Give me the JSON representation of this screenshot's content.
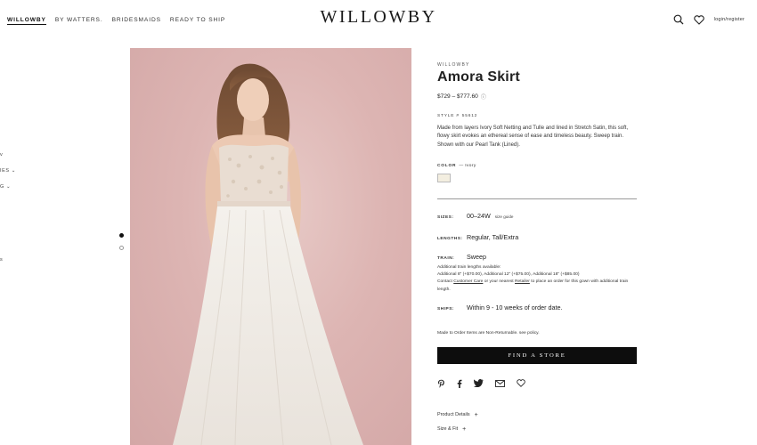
{
  "nav": {
    "links": [
      {
        "label": "WILLOWBY"
      },
      {
        "label": "BY WATTERS."
      },
      {
        "label": "BRIDESMAIDS"
      },
      {
        "label": "READY TO SHIP"
      }
    ],
    "logo": "WILLOWBY",
    "login": "login/register",
    "icons": [
      "search-icon",
      "heart-icon"
    ]
  },
  "side_fragments": [
    "v",
    "IES ⌄",
    "G ⌄",
    "s"
  ],
  "product": {
    "brand": "WILLOWBY",
    "title": "Amora Skirt",
    "price": "$729 – $777.60",
    "info_icon": "ⓘ",
    "style_label": "STYLE #",
    "style_number": "55612",
    "description": "Made from layers Ivory Soft Netting and Tulle and lined in Stretch Satin, this soft, flowy skirt evokes an ethereal sense of ease and timeless beauty. Sweep train. Shown with our Pearl Tank (Lined).",
    "color_label": "COLOR",
    "color_value": "— Ivory",
    "swatch_color": "#f3eee0",
    "sizes_label": "SIZES:",
    "sizes_value": "00–24W",
    "size_guide": "size guide",
    "lengths_label": "LENGTHS:",
    "lengths_value": "Regular, Tall/Extra",
    "train_label": "TRAIN:",
    "train_value": "Sweep",
    "train_note_1": "Additional train lengths available:",
    "train_note_2": "Additional 8\" (+$70.00), Additional 12\" (+$75.00), Additional 18\" (+$85.00)",
    "train_note_3a": "Contact ",
    "train_note_customer_care": "Customer Care",
    "train_note_3b": " or your nearest ",
    "train_note_retailer": "Retailer",
    "train_note_3c": " to place an order for this gown with additional train length.",
    "ships_label": "SHIPS:",
    "ships_value": "Within 9 - 10 weeks of order date.",
    "policy": "Made to Order Items are Non-Returnable. see policy.",
    "find_button": "FIND A STORE",
    "share_icons": [
      "pinterest-icon",
      "facebook-icon",
      "twitter-icon",
      "email-icon",
      "heart-icon"
    ],
    "accordions": [
      {
        "label": "Product Details",
        "icon": "+"
      },
      {
        "label": "Size & Fit",
        "icon": "+"
      }
    ]
  },
  "colors": {
    "photo_background": "#ddb5b3",
    "button": "#0d0d0d"
  }
}
